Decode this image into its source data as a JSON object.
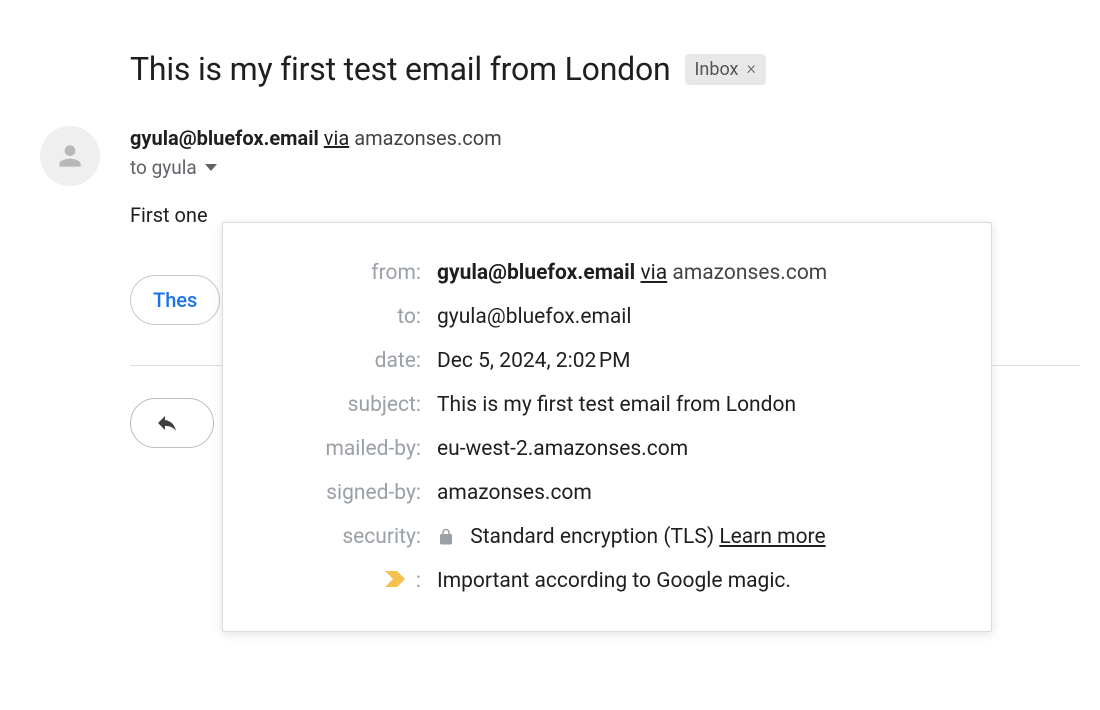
{
  "subject": "This is my first test email from London",
  "category": {
    "label": "Inbox"
  },
  "sender": {
    "email": "gyula@bluefox.email",
    "via_word": "via",
    "via_domain": "amazonses.com"
  },
  "to_summary": "to gyula",
  "body_preview": "First one",
  "actions": {
    "translate_visible": "Thes",
    "reply_visible": ""
  },
  "details": {
    "labels": {
      "from": "from:",
      "to": "to:",
      "date": "date:",
      "subject": "subject:",
      "mailed_by": "mailed-by:",
      "signed_by": "signed-by:",
      "security": "security:",
      "importance": ":"
    },
    "from": {
      "email": "gyula@bluefox.email",
      "via_word": "via",
      "via_domain": "amazonses.com"
    },
    "to": "gyula@bluefox.email",
    "date": "Dec 5, 2024, 2:02 PM",
    "subject": "This is my first test email from London",
    "mailed_by": "eu-west-2.amazonses.com",
    "signed_by": "amazonses.com",
    "security": {
      "text": "Standard encryption (TLS)",
      "learn_more": "Learn more"
    },
    "importance": "Important according to Google magic."
  }
}
